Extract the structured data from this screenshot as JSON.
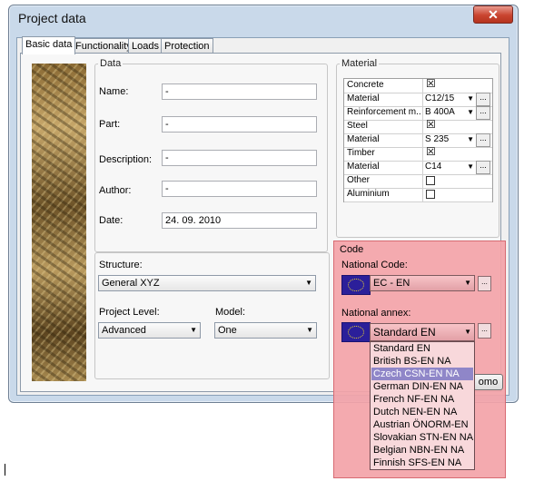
{
  "window": {
    "title": "Project data",
    "close_glyph": "✕"
  },
  "tabs": [
    {
      "label": "Basic data",
      "active": true
    },
    {
      "label": "Functionality",
      "active": false
    },
    {
      "label": "Loads",
      "active": false
    },
    {
      "label": "Protection",
      "active": false
    }
  ],
  "data_group": {
    "legend": "Data",
    "fields": [
      {
        "label": "Name:",
        "value": "-"
      },
      {
        "label": "Part:",
        "value": "-"
      },
      {
        "label": "Description:",
        "value": "-"
      },
      {
        "label": "Author:",
        "value": "-"
      },
      {
        "label": "Date:",
        "value": "24. 09. 2010"
      }
    ],
    "structure_label": "Structure:",
    "structure_value": "General XYZ",
    "project_level_label": "Project Level:",
    "project_level_value": "Advanced",
    "model_label": "Model:",
    "model_value": "One"
  },
  "material_group": {
    "legend": "Material",
    "rows": [
      {
        "label": "Concrete",
        "kind": "check",
        "checked": true
      },
      {
        "label": "Material",
        "kind": "select",
        "value": "C12/15"
      },
      {
        "label": "Reinforcement m...",
        "kind": "select",
        "value": "B 400A"
      },
      {
        "label": "Steel",
        "kind": "check",
        "checked": true
      },
      {
        "label": "Material",
        "kind": "select",
        "value": "S 235"
      },
      {
        "label": "Timber",
        "kind": "check",
        "checked": true
      },
      {
        "label": "Material",
        "kind": "select",
        "value": "C14"
      },
      {
        "label": "Other",
        "kind": "check",
        "checked": false
      },
      {
        "label": "Aluminium",
        "kind": "check",
        "checked": false
      }
    ],
    "dots_label": "..."
  },
  "code_group": {
    "legend": "Code",
    "national_code_label": "National Code:",
    "national_code_value": "EC - EN",
    "national_annex_label": "National annex:",
    "national_annex_value": "Standard EN",
    "dots_label": "...",
    "annex_options": [
      "Standard EN",
      "British BS-EN NA",
      "Czech CSN-EN NA",
      "German DIN-EN NA",
      "French NF-EN NA",
      "Dutch NEN-EN NA",
      "Austrian ÖNORM-EN",
      "Slovakian STN-EN NA",
      "Belgian NBN-EN NA",
      "Finnish SFS-EN NA"
    ],
    "highlighted_option": "Czech CSN-EN NA"
  },
  "partial_button": {
    "label": "omo"
  },
  "colors": {
    "highlight_box": "#f3a3a8",
    "eu_flag": "#2b1f9a",
    "selected_item": "#8f86c8"
  }
}
